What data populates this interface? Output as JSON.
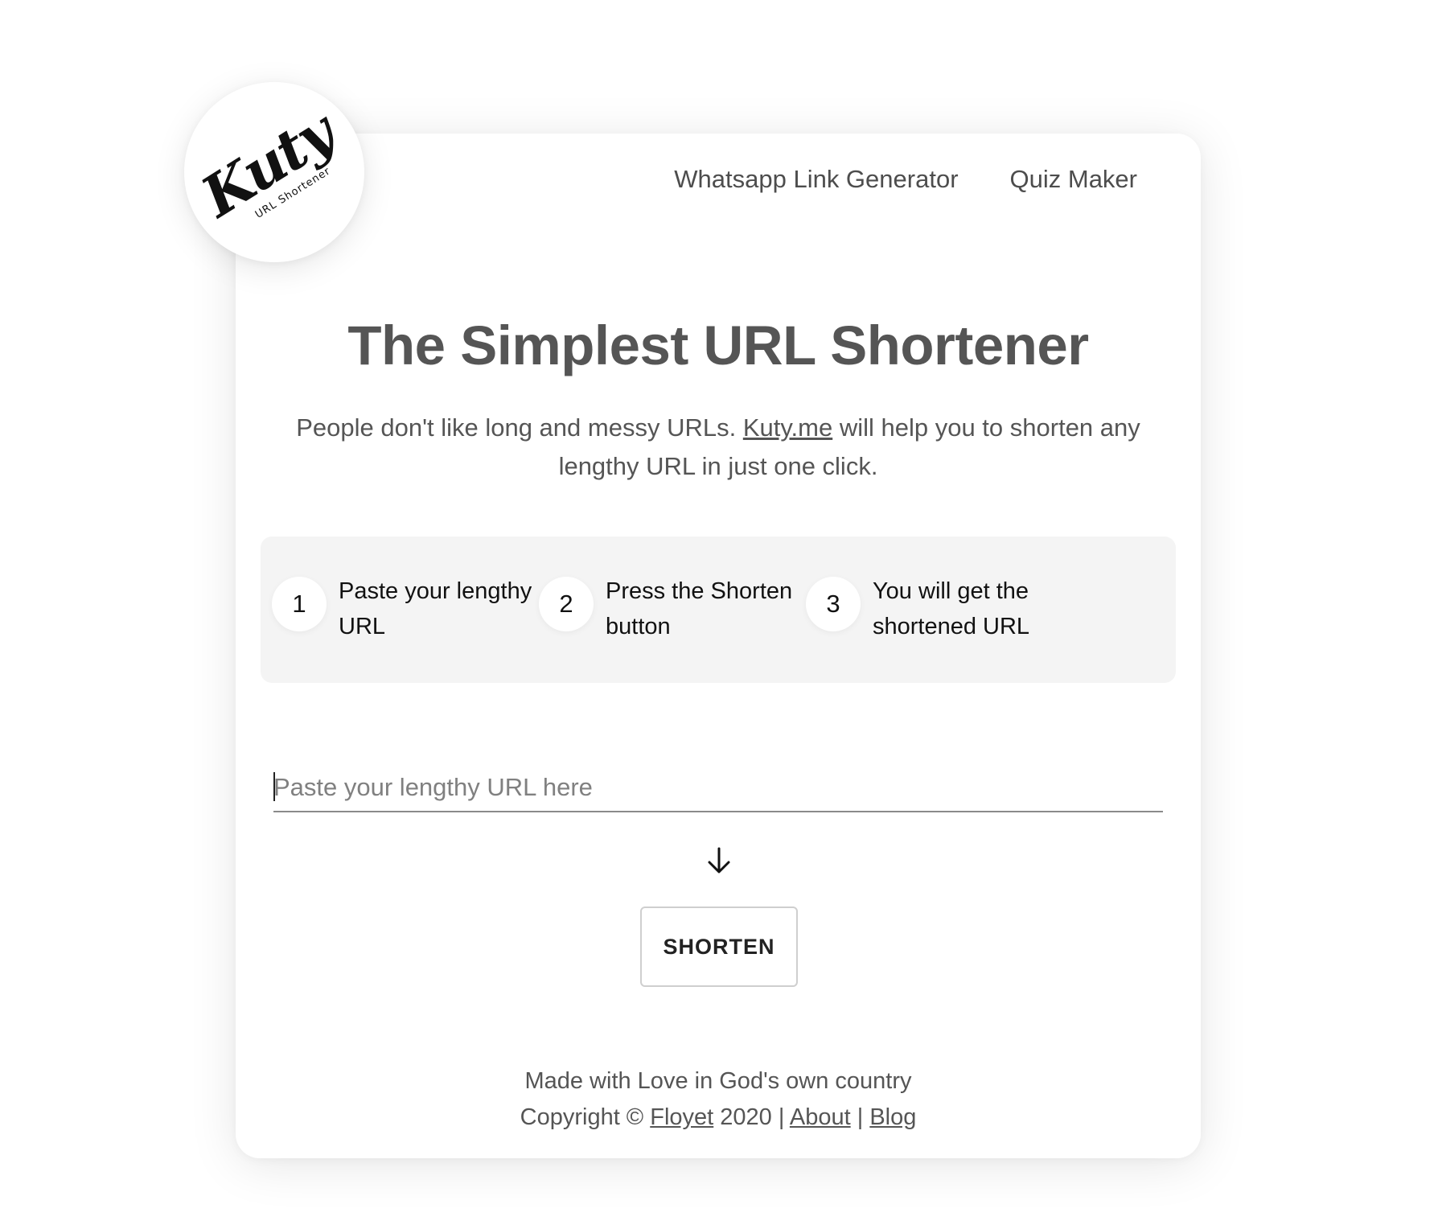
{
  "logo": {
    "wordmark": "Kuty",
    "tagline": "URL Shortener"
  },
  "nav": {
    "items": [
      {
        "label": "Whatsapp Link Generator"
      },
      {
        "label": "Quiz Maker"
      }
    ]
  },
  "hero": {
    "title": "The Simplest URL Shortener",
    "desc_before": "People don't like long and messy URLs. ",
    "desc_link": "Kuty.me",
    "desc_after": " will help you to shorten any lengthy URL in just one click."
  },
  "steps": [
    {
      "number": "1",
      "text": "Paste your lengthy URL"
    },
    {
      "number": "2",
      "text": "Press the Shorten button"
    },
    {
      "number": "3",
      "text": "You will get the shortened URL"
    }
  ],
  "form": {
    "input_value": "",
    "input_placeholder": "Paste your lengthy URL here",
    "arrow_icon": "arrow-down-icon",
    "button_label": "SHORTEN"
  },
  "footer": {
    "line1": "Made with Love in God's own country",
    "copyright_prefix": "Copyright © ",
    "company_link": "Floyet",
    "year_sep": " 2020 | ",
    "about_link": "About",
    "sep": " | ",
    "blog_link": "Blog"
  }
}
